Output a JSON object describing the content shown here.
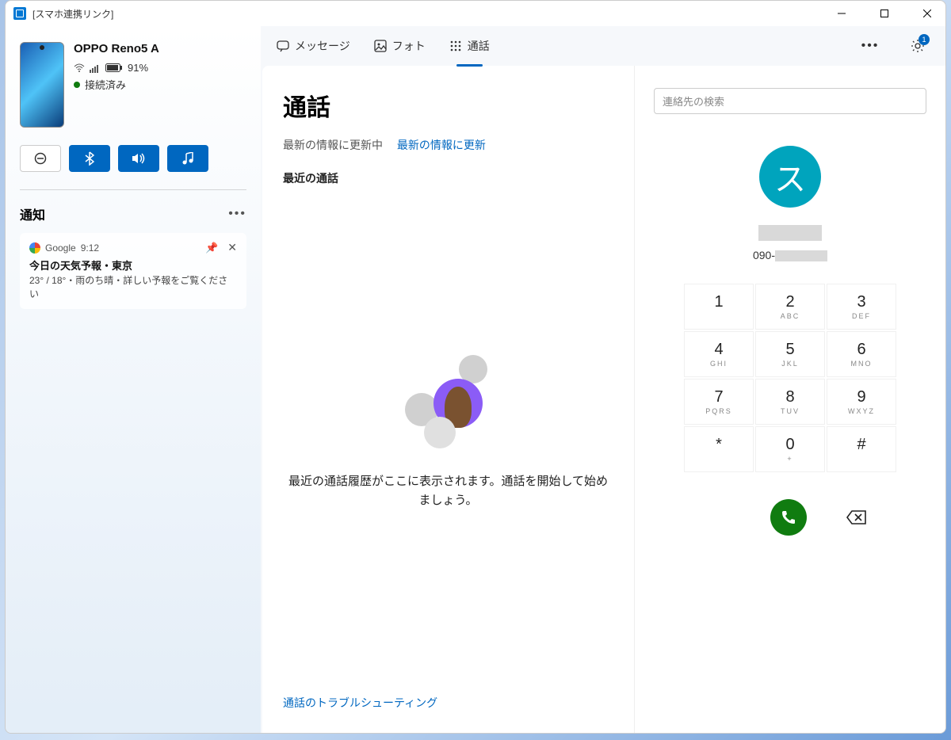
{
  "window": {
    "title": "[スマホ連携リンク]"
  },
  "device": {
    "name": "OPPO Reno5 A",
    "battery_text": "91%",
    "connection_status": "接続済み"
  },
  "notifications": {
    "header": "通知",
    "items": [
      {
        "app": "Google",
        "time": "9:12",
        "title": "今日の天気予報・東京",
        "body": "23° / 18°・雨のち晴・詳しい予報をご覧ください"
      }
    ]
  },
  "tabs": {
    "messages": "メッセージ",
    "photos": "フォト",
    "calls": "通話",
    "active": "calls"
  },
  "header": {
    "settings_badge": "1"
  },
  "calls": {
    "title": "通話",
    "refreshing": "最新の情報に更新中",
    "refresh_link": "最新の情報に更新",
    "recent_header": "最近の通話",
    "empty_text": "最近の通話履歴がここに表示されます。通話を開始して始めましょう。",
    "troubleshoot": "通話のトラブルシューティング"
  },
  "dialer": {
    "search_placeholder": "連絡先の検索",
    "avatar_letter": "ス",
    "phone_prefix": "090-",
    "keys": [
      {
        "num": "1",
        "ltr": ""
      },
      {
        "num": "2",
        "ltr": "ABC"
      },
      {
        "num": "3",
        "ltr": "DEF"
      },
      {
        "num": "4",
        "ltr": "GHI"
      },
      {
        "num": "5",
        "ltr": "JKL"
      },
      {
        "num": "6",
        "ltr": "MNO"
      },
      {
        "num": "7",
        "ltr": "PQRS"
      },
      {
        "num": "8",
        "ltr": "TUV"
      },
      {
        "num": "9",
        "ltr": "WXYZ"
      },
      {
        "num": "*",
        "ltr": ""
      },
      {
        "num": "0",
        "ltr": "+"
      },
      {
        "num": "#",
        "ltr": ""
      }
    ]
  }
}
